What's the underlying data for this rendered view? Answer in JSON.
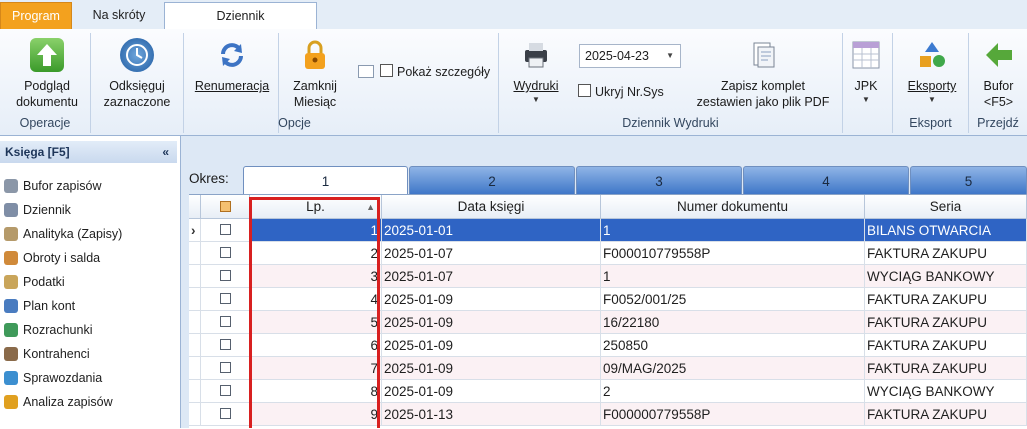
{
  "tabs": {
    "program": "Program",
    "skroty": "Na skróty",
    "dziennik": "Dziennik"
  },
  "ribbon": {
    "podglad": "Podgląd\ndokumentu",
    "odksieguj": "Odksięguj\nzaznaczone",
    "renumeracja": "Renumeracja",
    "zamknij": "Zamknij\nMiesiąc",
    "pokaz": "Pokaż szczegóły",
    "wydruki": "Wydruki",
    "date": "2025-04-23",
    "ukryj": "Ukryj Nr.Sys",
    "zapisz": "Zapisz komplet\nzestawien jako plik PDF",
    "jpk": "JPK",
    "eksporty": "Eksporty",
    "bufor": "Bufor\n<F5>",
    "groups": {
      "operacje": "Operacje",
      "opcje": "Opcje",
      "dziennik_wydruki": "Dziennik Wydruki",
      "eksport": "Eksport",
      "przejdz": "Przejdź"
    }
  },
  "sidebar": {
    "title": "Księga [F5]",
    "collapse": "«",
    "items": [
      {
        "label": "Bufor zapisów",
        "icon": "buffer-icon",
        "color": "#8b97a8"
      },
      {
        "label": "Dziennik",
        "icon": "journal-icon",
        "color": "#7f8ea6"
      },
      {
        "label": "Analityka (Zapisy)",
        "icon": "analytics-icon",
        "color": "#b59a6a"
      },
      {
        "label": "Obroty i salda",
        "icon": "balance-icon",
        "color": "#d08a3a"
      },
      {
        "label": "Podatki",
        "icon": "tax-icon",
        "color": "#c9a55a"
      },
      {
        "label": "Plan kont",
        "icon": "accounts-plan-icon",
        "color": "#4a7cc0"
      },
      {
        "label": "Rozrachunki",
        "icon": "settlements-icon",
        "color": "#3f9a5a"
      },
      {
        "label": "Kontrahenci",
        "icon": "contractors-icon",
        "color": "#8a6a4a"
      },
      {
        "label": "Sprawozdania",
        "icon": "reports-icon",
        "color": "#3c8fd0"
      },
      {
        "label": "Analiza zapisów",
        "icon": "entries-analysis-icon",
        "color": "#e0a020"
      }
    ]
  },
  "period": {
    "label": "Okres:",
    "tabs": [
      "1",
      "2",
      "3",
      "4",
      "5"
    ],
    "selected": "1"
  },
  "grid": {
    "headers": {
      "lp": "Lp.",
      "sort": "▲",
      "data": "Data księgi",
      "numer": "Numer dokumentu",
      "seria": "Seria"
    },
    "rows": [
      {
        "lp": "1",
        "data": "2025-01-01",
        "numer": "1",
        "seria": "BILANS OTWARCIA"
      },
      {
        "lp": "2",
        "data": "2025-01-07",
        "numer": "F000010779558P",
        "seria": "FAKTURA ZAKUPU"
      },
      {
        "lp": "3",
        "data": "2025-01-07",
        "numer": "1",
        "seria": "WYCIĄG BANKOWY"
      },
      {
        "lp": "4",
        "data": "2025-01-09",
        "numer": "F0052/001/25",
        "seria": "FAKTURA ZAKUPU"
      },
      {
        "lp": "5",
        "data": "2025-01-09",
        "numer": "16/22180",
        "seria": "FAKTURA ZAKUPU"
      },
      {
        "lp": "6",
        "data": "2025-01-09",
        "numer": "250850",
        "seria": "FAKTURA ZAKUPU"
      },
      {
        "lp": "7",
        "data": "2025-01-09",
        "numer": "09/MAG/2025",
        "seria": "FAKTURA ZAKUPU"
      },
      {
        "lp": "8",
        "data": "2025-01-09",
        "numer": "2",
        "seria": "WYCIĄG BANKOWY"
      },
      {
        "lp": "9",
        "data": "2025-01-13",
        "numer": "F000000779558P",
        "seria": "FAKTURA ZAKUPU"
      }
    ],
    "selected_row": "1",
    "current_row_marker": "›"
  },
  "colors": {
    "accent_orange": "#f3a11e",
    "selection_blue": "#2f64c4",
    "highlight_red": "#d82020"
  }
}
